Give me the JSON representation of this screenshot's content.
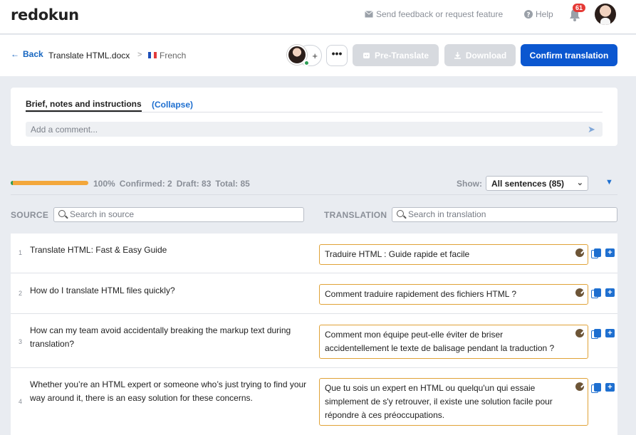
{
  "app": {
    "logo": "redokun"
  },
  "topnav": {
    "feedback": "Send feedback or request feature",
    "help": "Help",
    "notification_count": "61"
  },
  "toolbar": {
    "back": "Back",
    "filename": "Translate HTML.docx",
    "separator": ">",
    "language": "French",
    "more": "•••",
    "pretranslate": "Pre-Translate",
    "download": "Download",
    "confirm": "Confirm translation"
  },
  "brief": {
    "title": "Brief, notes and instructions",
    "collapse": "(Collapse)",
    "comment_placeholder": "Add a comment..."
  },
  "stats": {
    "progress_fraction": 1.0,
    "percent": "100%",
    "confirmed": "Confirmed: 2",
    "draft": "Draft: 83",
    "total": "Total: 85",
    "show_label": "Show:",
    "show_value": "All sentences (85)"
  },
  "columns": {
    "source_label": "SOURCE",
    "source_placeholder": "Search in source",
    "translation_label": "TRANSLATION",
    "translation_placeholder": "Search in translation"
  },
  "rows": [
    {
      "num": "1",
      "source": "Translate HTML: Fast & Easy Guide",
      "translation": "Traduire HTML : Guide rapide et facile"
    },
    {
      "num": "2",
      "source": "How do I translate HTML files quickly?",
      "translation": "Comment traduire rapidement des fichiers HTML ?"
    },
    {
      "num": "3",
      "source": "How can my team avoid accidentally breaking the markup text during translation?",
      "translation": "Comment mon équipe peut-elle éviter de briser accidentellement le texte de balisage pendant la traduction ?"
    },
    {
      "num": "4",
      "source": "Whether you’re an HTML expert or someone who’s just trying to find your way around it, there is an easy solution for these concerns.",
      "translation": "Que tu sois un expert en HTML ou quelqu'un qui essaie simplement de s'y retrouver, il existe une solution facile pour répondre à ces préoccupations."
    }
  ],
  "colors": {
    "primary": "#0b57d0",
    "accent_link": "#1e6fd0",
    "progress": "#f3a73b",
    "draft_border": "#e0a237",
    "badge": "#e53935"
  }
}
